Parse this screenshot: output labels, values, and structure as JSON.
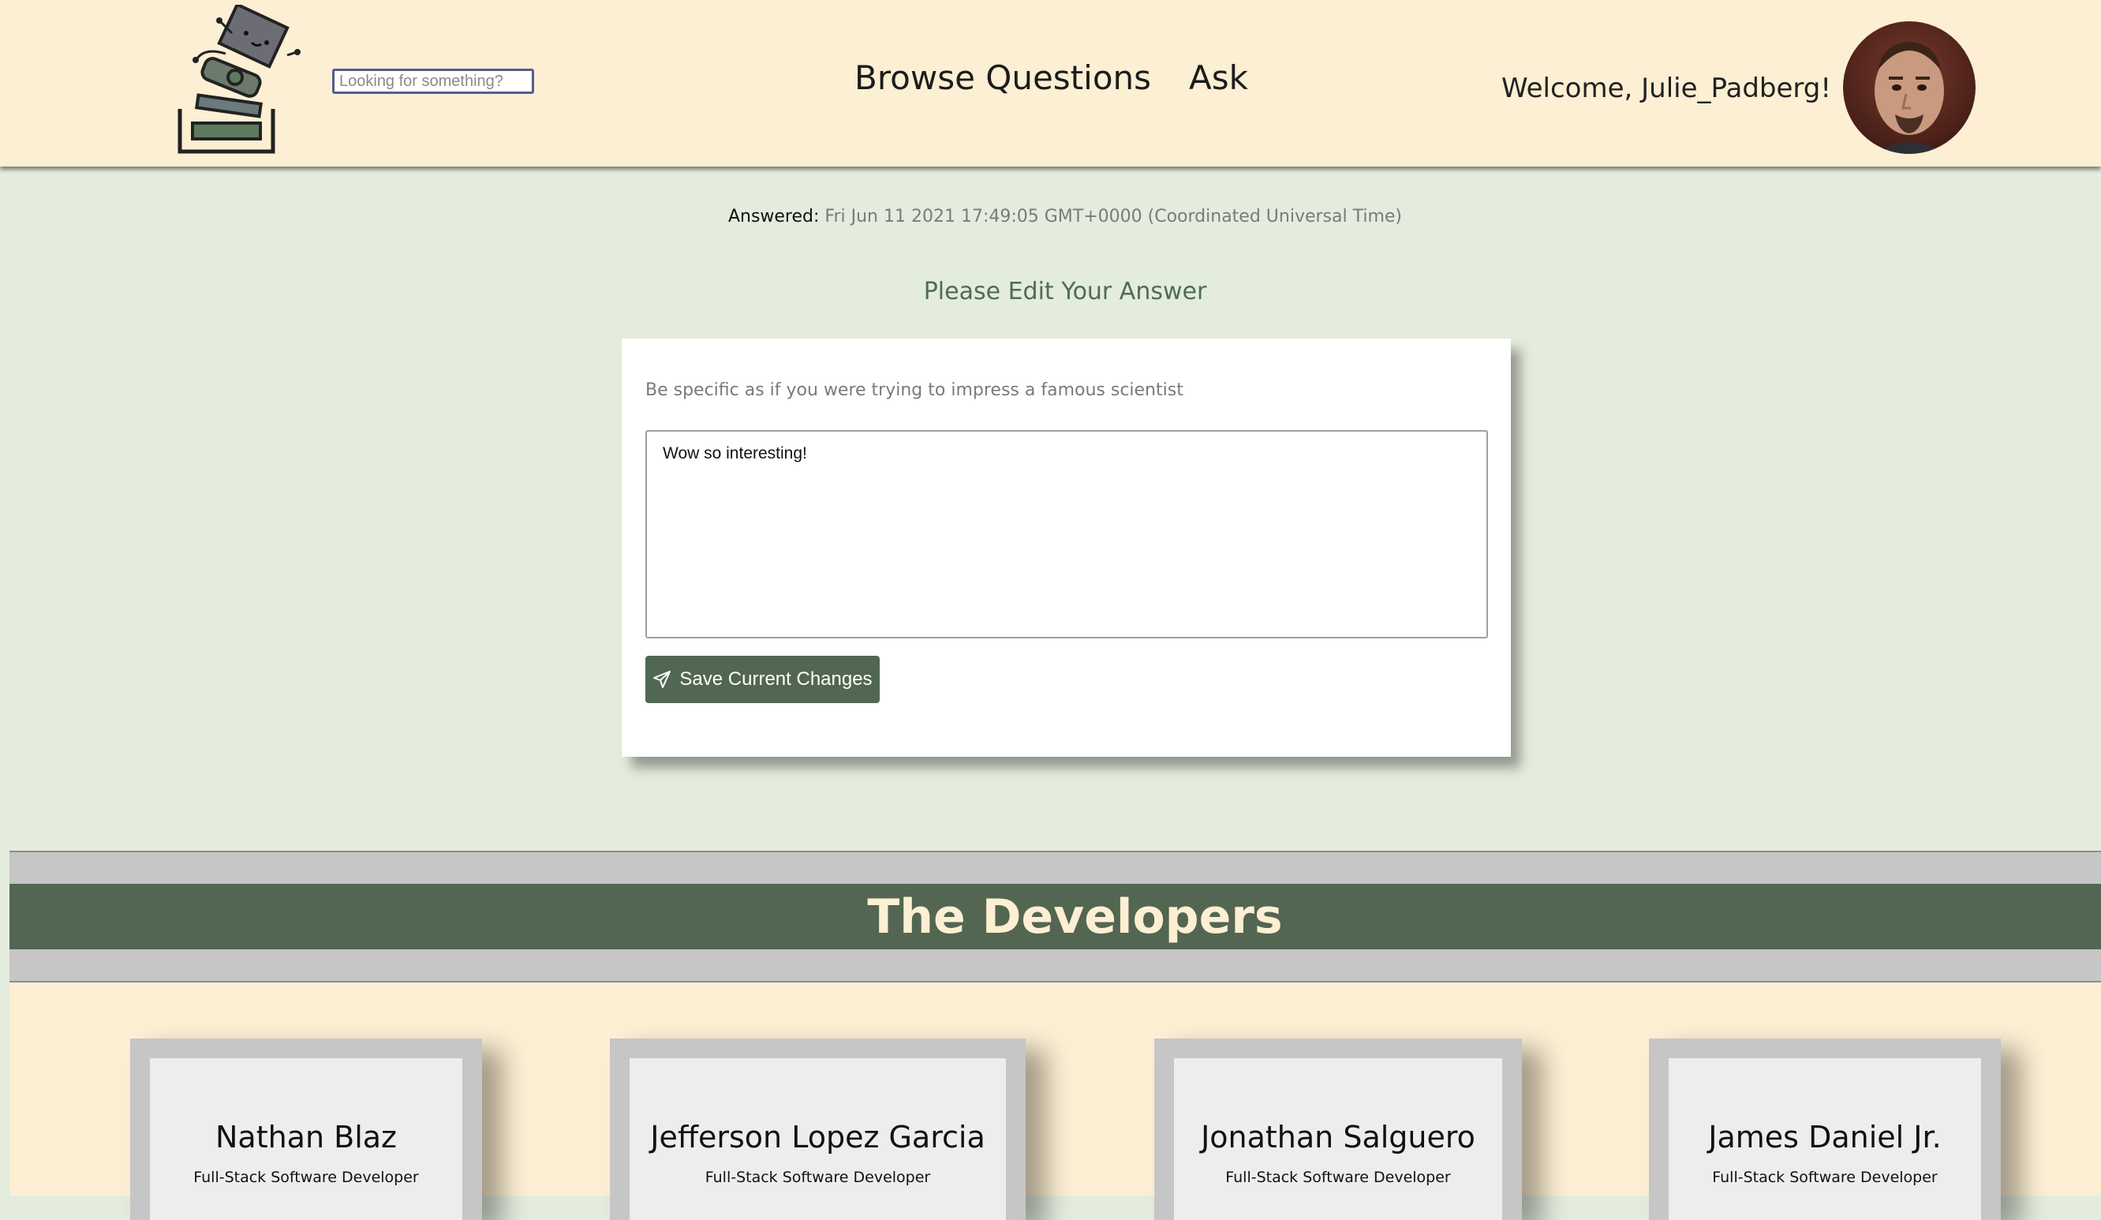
{
  "header": {
    "search_placeholder": "Looking for something?",
    "nav": [
      "Browse Questions",
      "Ask"
    ],
    "welcome": "Welcome, Julie_Padberg!"
  },
  "answer": {
    "answered_label": "Answered:",
    "answered_date": "Fri Jun 11 2021 17:49:05 GMT+0000 (Coordinated Universal Time)",
    "title": "Please Edit Your Answer",
    "hint": "Be specific as if you were trying to impress a famous scientist",
    "text": "Wow so interesting!",
    "save_label": "Save Current Changes"
  },
  "footer": {
    "heading": "The Developers",
    "developers": [
      {
        "name": "Nathan Blaz",
        "role": "Full-Stack Software Developer"
      },
      {
        "name": "Jefferson Lopez Garcia",
        "role": "Full-Stack Software Developer"
      },
      {
        "name": "Jonathan Salguero",
        "role": "Full-Stack Software Developer"
      },
      {
        "name": "James Daniel Jr.",
        "role": "Full-Stack Software Developer"
      }
    ]
  },
  "colors": {
    "header_bg": "#fdefd3",
    "page_bg": "#e4ecdd",
    "accent_green": "#516751",
    "band_gray": "#c6c6c6"
  },
  "icons": {
    "logo": "robot-with-stacked-books-logo",
    "save": "paper-plane-icon"
  }
}
